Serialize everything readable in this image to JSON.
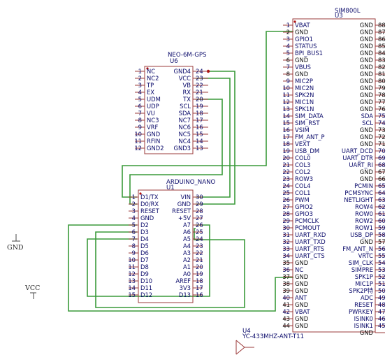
{
  "components": {
    "gps": {
      "ref": "U6",
      "value": "NEO-6M-GPS",
      "left_pins": [
        {
          "num": "1",
          "name": "NC"
        },
        {
          "num": "2",
          "name": "NC2"
        },
        {
          "num": "3",
          "name": "TP"
        },
        {
          "num": "4",
          "name": "EX"
        },
        {
          "num": "5",
          "name": "UDM"
        },
        {
          "num": "6",
          "name": "UDP"
        },
        {
          "num": "7",
          "name": "VU"
        },
        {
          "num": "8",
          "name": "NC3"
        },
        {
          "num": "9",
          "name": "VRF"
        },
        {
          "num": "10",
          "name": "GND"
        },
        {
          "num": "11",
          "name": "RFIN"
        },
        {
          "num": "12",
          "name": "GND2"
        }
      ],
      "right_pins": [
        {
          "num": "24",
          "name": "GND4"
        },
        {
          "num": "23",
          "name": "VCC"
        },
        {
          "num": "22",
          "name": "VB"
        },
        {
          "num": "21",
          "name": "RX"
        },
        {
          "num": "20",
          "name": "TX"
        },
        {
          "num": "19",
          "name": "SCL"
        },
        {
          "num": "18",
          "name": "SDA"
        },
        {
          "num": "17",
          "name": "NC7"
        },
        {
          "num": "16",
          "name": "NC6"
        },
        {
          "num": "15",
          "name": "NC5"
        },
        {
          "num": "14",
          "name": "NC4"
        },
        {
          "num": "13",
          "name": "GND3"
        }
      ]
    },
    "nano": {
      "ref": "U1",
      "value": "ARDUINO_NANO",
      "left_pins": [
        {
          "num": "1",
          "name": "D1/TX"
        },
        {
          "num": "2",
          "name": "D0/RX"
        },
        {
          "num": "3",
          "name": "RESET"
        },
        {
          "num": "4",
          "name": "GND"
        },
        {
          "num": "5",
          "name": "D2"
        },
        {
          "num": "6",
          "name": "D3"
        },
        {
          "num": "7",
          "name": "D4"
        },
        {
          "num": "8",
          "name": "D5"
        },
        {
          "num": "9",
          "name": "D6"
        },
        {
          "num": "10",
          "name": "D7"
        },
        {
          "num": "11",
          "name": "D8"
        },
        {
          "num": "12",
          "name": "D9"
        },
        {
          "num": "13",
          "name": "D10"
        },
        {
          "num": "14",
          "name": "D11"
        },
        {
          "num": "15",
          "name": "D12"
        }
      ],
      "right_pins": [
        {
          "num": "30",
          "name": "VIN"
        },
        {
          "num": "29",
          "name": "GND"
        },
        {
          "num": "28",
          "name": "RESET"
        },
        {
          "num": "27",
          "name": "+5V"
        },
        {
          "num": "26",
          "name": "A7"
        },
        {
          "num": "25",
          "name": "A6"
        },
        {
          "num": "24",
          "name": "A5"
        },
        {
          "num": "23",
          "name": "A4"
        },
        {
          "num": "22",
          "name": "A3"
        },
        {
          "num": "21",
          "name": "A2"
        },
        {
          "num": "20",
          "name": "A1"
        },
        {
          "num": "19",
          "name": "A0"
        },
        {
          "num": "18",
          "name": "AREF"
        },
        {
          "num": "17",
          "name": "3V3"
        },
        {
          "num": "16",
          "name": "D13"
        }
      ]
    },
    "sim": {
      "ref": "U3",
      "value": "SIM800L",
      "left_pins": [
        {
          "num": "1",
          "name": "VBAT"
        },
        {
          "num": "2",
          "name": "GND"
        },
        {
          "num": "3",
          "name": "GPIO1"
        },
        {
          "num": "4",
          "name": "STATUS"
        },
        {
          "num": "5",
          "name": "BPI_BUS1"
        },
        {
          "num": "6",
          "name": "GND"
        },
        {
          "num": "7",
          "name": "VBUS"
        },
        {
          "num": "8",
          "name": "GND"
        },
        {
          "num": "9",
          "name": "MIC2P"
        },
        {
          "num": "10",
          "name": "MIC2N"
        },
        {
          "num": "11",
          "name": "SPK2N"
        },
        {
          "num": "12",
          "name": "MIC1N"
        },
        {
          "num": "13",
          "name": "SPK1N"
        },
        {
          "num": "14",
          "name": "SIM_DATA"
        },
        {
          "num": "15",
          "name": "SIM_RST"
        },
        {
          "num": "16",
          "name": "VSIM"
        },
        {
          "num": "17",
          "name": "FM_ANT_P"
        },
        {
          "num": "18",
          "name": "VEXT"
        },
        {
          "num": "19",
          "name": "USB_DM"
        },
        {
          "num": "20",
          "name": "COL0"
        },
        {
          "num": "21",
          "name": "COL3"
        },
        {
          "num": "22",
          "name": "COL2"
        },
        {
          "num": "23",
          "name": "ROW3"
        },
        {
          "num": "24",
          "name": "COL4"
        },
        {
          "num": "25",
          "name": "COL1"
        },
        {
          "num": "26",
          "name": "PWM"
        },
        {
          "num": "27",
          "name": "GPIO2"
        },
        {
          "num": "28",
          "name": "GPIO3"
        },
        {
          "num": "29",
          "name": "PCMCLK"
        },
        {
          "num": "30",
          "name": "PCMOUT"
        },
        {
          "num": "31",
          "name": "UART_RXD"
        },
        {
          "num": "32",
          "name": "UART_TXD"
        },
        {
          "num": "33",
          "name": "UART_RTS"
        },
        {
          "num": "34",
          "name": "UART_CTS"
        },
        {
          "num": "35",
          "name": "GND"
        },
        {
          "num": "36",
          "name": "NC"
        },
        {
          "num": "37",
          "name": "GND"
        },
        {
          "num": "38",
          "name": "GND"
        },
        {
          "num": "39",
          "name": "GND"
        },
        {
          "num": "40",
          "name": "ANT"
        },
        {
          "num": "41",
          "name": "GND"
        },
        {
          "num": "42",
          "name": "VBAT"
        },
        {
          "num": "43",
          "name": "GND"
        },
        {
          "num": "44",
          "name": "GND"
        }
      ],
      "right_pins": [
        {
          "num": "88",
          "name": "GND"
        },
        {
          "num": "87",
          "name": "GND"
        },
        {
          "num": "86",
          "name": "GND"
        },
        {
          "num": "85",
          "name": "GND"
        },
        {
          "num": "84",
          "name": "GND"
        },
        {
          "num": "83",
          "name": "GND"
        },
        {
          "num": "82",
          "name": "GND"
        },
        {
          "num": "81",
          "name": "GND"
        },
        {
          "num": "80",
          "name": "GND"
        },
        {
          "num": "79",
          "name": "GND"
        },
        {
          "num": "78",
          "name": "GND"
        },
        {
          "num": "77",
          "name": "GND"
        },
        {
          "num": "76",
          "name": "GND"
        },
        {
          "num": "75",
          "name": "SDA"
        },
        {
          "num": "74",
          "name": "SCL"
        },
        {
          "num": "73",
          "name": "GND"
        },
        {
          "num": "72",
          "name": "GND"
        },
        {
          "num": "71",
          "name": "GND"
        },
        {
          "num": "70",
          "name": "UART_DCD"
        },
        {
          "num": "69",
          "name": "UART_DTR"
        },
        {
          "num": "68",
          "name": "UART_RI"
        },
        {
          "num": "67",
          "name": "GND"
        },
        {
          "num": "66",
          "name": "GND"
        },
        {
          "num": "65",
          "name": "PCMIN"
        },
        {
          "num": "64",
          "name": "PCMSYNC"
        },
        {
          "num": "63",
          "name": "NETLIGHT"
        },
        {
          "num": "62",
          "name": "ROW4"
        },
        {
          "num": "61",
          "name": "ROW0"
        },
        {
          "num": "60",
          "name": "ROW2"
        },
        {
          "num": "59",
          "name": "ROW1"
        },
        {
          "num": "58",
          "name": "USB_DP"
        },
        {
          "num": "57",
          "name": "GND"
        },
        {
          "num": "56",
          "name": "FM_ANT_N"
        },
        {
          "num": "55",
          "name": "VRTC"
        },
        {
          "num": "54",
          "name": "SIM_CLK"
        },
        {
          "num": "53",
          "name": "SIMPRE"
        },
        {
          "num": "52",
          "name": "SPK1P"
        },
        {
          "num": "51",
          "name": "MIC1P"
        },
        {
          "num": "50",
          "name": "SPK2P特"
        },
        {
          "num": "49",
          "name": "ADC"
        },
        {
          "num": "48",
          "name": "RESET"
        },
        {
          "num": "47",
          "name": "PWRKEY"
        },
        {
          "num": "46",
          "name": "ISINK0"
        },
        {
          "num": "45",
          "name": "ISINK1"
        },
        {
          "num": "",
          "name": "GND"
        }
      ]
    },
    "antenna": {
      "ref": "U4",
      "value": "YC-433MHZ-ANT-T11"
    },
    "power": {
      "gnd_label": "GND",
      "vcc_label": "VCC"
    }
  },
  "colors": {
    "wire": "#3a9a3a",
    "body": "#9b3b3b",
    "pin_text": "#0b0b6b",
    "junction": "#b01010"
  }
}
